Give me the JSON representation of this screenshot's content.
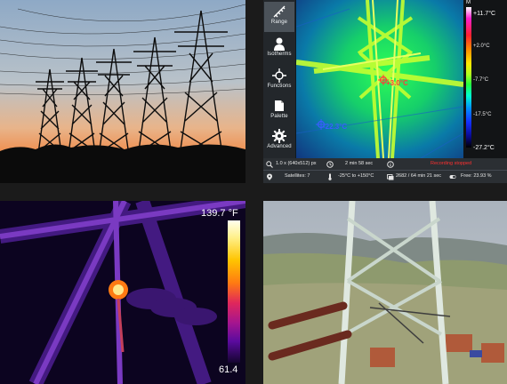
{
  "sidebar": {
    "items": [
      {
        "label": "Range",
        "icon": "range-icon",
        "active": true
      },
      {
        "label": "Isotherms",
        "icon": "isotherms-icon",
        "active": false
      },
      {
        "label": "Functions",
        "icon": "functions-icon",
        "active": false
      },
      {
        "label": "Palette",
        "icon": "palette-icon",
        "active": false
      },
      {
        "label": "Advanced",
        "icon": "gear-icon",
        "active": false
      }
    ]
  },
  "scale": {
    "marker": "M",
    "max": "+11.7°C",
    "mid1": "+2.0°C",
    "mid2": "-7.7°C",
    "mid3": "-17.5°C",
    "min": "-27.2°C"
  },
  "spots": {
    "hot": "+3.0°C",
    "cold": "-22.3°C"
  },
  "info": {
    "zoom": "1.0 x (640x512) px",
    "timer": "2 min 58 sec",
    "status": "Recording stopped",
    "satellites": "Satellites: 7",
    "range": "-25°C to +150°C",
    "storage": "2682 / 64 min 21 sec",
    "free": "Free: 23.93 %"
  },
  "ir_view": {
    "max": "139.7 °F",
    "min": "61.4"
  },
  "colors": {
    "status_red": "#ff3030",
    "hot_marker": "#ff3a3a",
    "cold_marker": "#3a5cff"
  }
}
